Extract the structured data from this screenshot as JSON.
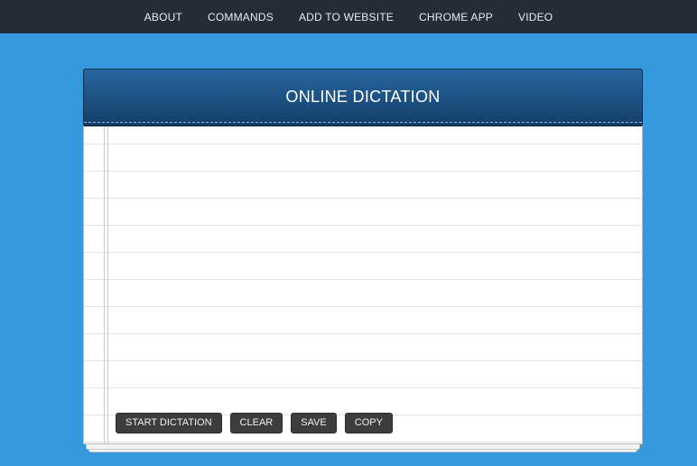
{
  "nav": {
    "items": [
      {
        "label": "ABOUT"
      },
      {
        "label": "COMMANDS"
      },
      {
        "label": "ADD TO WEBSITE"
      },
      {
        "label": "CHROME APP"
      },
      {
        "label": "VIDEO"
      }
    ]
  },
  "panel": {
    "title": "ONLINE DICTATION",
    "text_value": ""
  },
  "buttons": {
    "start": "START DICTATION",
    "clear": "CLEAR",
    "save": "SAVE",
    "copy": "COPY"
  },
  "colors": {
    "page_background": "#3597dc",
    "nav_background": "#232d36",
    "header_background": "#1d5585",
    "button_background": "#3d3d3d"
  }
}
